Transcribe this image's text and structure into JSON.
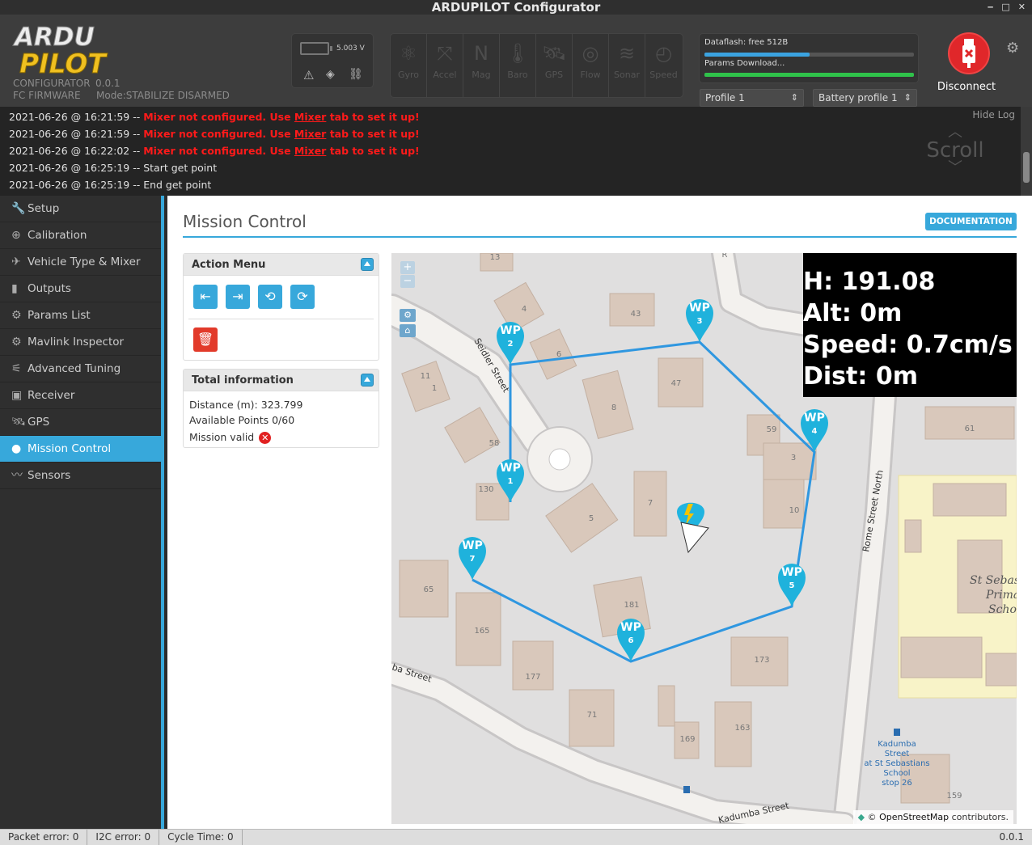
{
  "window": {
    "title": "ARDUPILOT Configurator",
    "controls": [
      "‒",
      "□",
      "✕"
    ]
  },
  "header": {
    "logo_top": "ARDU",
    "logo_bottom": "PILOT",
    "configurator_label": "CONFIGURATOR",
    "version": "0.0.1",
    "fc_firmware_label": "FC FIRMWARE",
    "mode": "Mode:STABILIZE DISARMED",
    "voltage": "5.003 V",
    "status_icons": [
      "warning-icon",
      "gps-fix-icon",
      "link-icon"
    ],
    "sensors": [
      {
        "label": "Gyro",
        "icon": "gyro-icon"
      },
      {
        "label": "Accel",
        "icon": "accel-icon"
      },
      {
        "label": "Mag",
        "icon": "mag-icon"
      },
      {
        "label": "Baro",
        "icon": "baro-icon"
      },
      {
        "label": "GPS",
        "icon": "gps-icon"
      },
      {
        "label": "Flow",
        "icon": "flow-icon"
      },
      {
        "label": "Sonar",
        "icon": "sonar-icon"
      },
      {
        "label": "Speed",
        "icon": "speed-icon"
      }
    ],
    "dataflash_label": "Dataflash: free 512B",
    "dataflash_fraction": 0.5,
    "params_label": "Params Download...",
    "params_fraction": 1.0,
    "profile": "Profile 1",
    "battery_profile": "Battery profile 1",
    "disconnect_label": "Disconnect"
  },
  "log": {
    "hide_label": "Hide Log",
    "scroll_label": "Scroll",
    "lines": [
      {
        "time": "2021-06-26 @ 16:21:59 -- ",
        "pre": "Mixer not configured. Use ",
        "link": "Mixer",
        "post": " tab to set it up!",
        "plain": ""
      },
      {
        "time": "2021-06-26 @ 16:21:59 -- ",
        "pre": "Mixer not configured. Use ",
        "link": "Mixer",
        "post": " tab to set it up!",
        "plain": ""
      },
      {
        "time": "2021-06-26 @ 16:22:02 -- ",
        "pre": "Mixer not configured. Use ",
        "link": "Mixer",
        "post": " tab to set it up!",
        "plain": ""
      },
      {
        "time": "2021-06-26 @ 16:25:19 -- ",
        "pre": "",
        "link": "",
        "post": "",
        "plain": "Start get point"
      },
      {
        "time": "2021-06-26 @ 16:25:19 -- ",
        "pre": "",
        "link": "",
        "post": "",
        "plain": "End get point"
      }
    ]
  },
  "sidebar": {
    "items": [
      {
        "label": "Setup",
        "icon": "wrench-icon",
        "active": false
      },
      {
        "label": "Calibration",
        "icon": "crosshair-icon",
        "active": false
      },
      {
        "label": "Vehicle Type & Mixer",
        "icon": "vehicle-icon",
        "active": false
      },
      {
        "label": "Outputs",
        "icon": "outputs-icon",
        "active": false
      },
      {
        "label": "Params List",
        "icon": "gear-icon",
        "active": false
      },
      {
        "label": "Mavlink Inspector",
        "icon": "gear-icon",
        "active": false
      },
      {
        "label": "Advanced Tuning",
        "icon": "tuning-icon",
        "active": false
      },
      {
        "label": "Receiver",
        "icon": "receiver-icon",
        "active": false
      },
      {
        "label": "GPS",
        "icon": "satellite-icon",
        "active": false
      },
      {
        "label": "Mission Control",
        "icon": "map-pin-icon",
        "active": true
      },
      {
        "label": "Sensors",
        "icon": "pulse-icon",
        "active": false
      }
    ]
  },
  "main": {
    "title": "Mission Control",
    "documentation_label": "DOCUMENTATION",
    "action_menu": {
      "title": "Action Menu",
      "buttons": [
        "load-from-file",
        "save-to-file",
        "load-from-fc",
        "save-to-fc"
      ],
      "delete_icon": "trash-icon"
    },
    "total_info": {
      "title": "Total information",
      "distance": "Distance (m): 323.799",
      "points": "Available Points 0/60",
      "valid": "Mission valid"
    }
  },
  "map": {
    "hud": {
      "heading": "H: 191.08",
      "alt": "Alt: 0m",
      "speed": "Speed: 0.7cm/s",
      "dist": "Dist: 0m"
    },
    "zoom_in": "+",
    "zoom_out": "−",
    "attribution_pre": "© ",
    "attribution_link": "OpenStreetMap",
    "attribution_post": " contributors.",
    "waypoint_label": "WP",
    "streets": [
      "Seidler Street",
      "Rome Street North",
      "Kadumba Street",
      "ba Street"
    ],
    "place": {
      "l1": "St Sebas",
      "l2": "Prima",
      "l3": "Schoo"
    },
    "bus_stop": [
      "Kadumba",
      "Street",
      "at St Sebastians",
      "School",
      "stop 26"
    ],
    "house_numbers": [
      "13",
      "4",
      "43",
      "R",
      "6",
      "11",
      "1",
      "47",
      "8",
      "59",
      "3",
      "61",
      "58",
      "5",
      "7",
      "10",
      "65",
      "181",
      "165",
      "177",
      "173",
      "71",
      "169",
      "163",
      "159",
      "130",
      "6"
    ],
    "waypoints": [
      {
        "n": "1"
      },
      {
        "n": "2"
      },
      {
        "n": "3"
      },
      {
        "n": "4"
      },
      {
        "n": "5"
      },
      {
        "n": "6"
      },
      {
        "n": "7"
      }
    ]
  },
  "status": {
    "packet_error": "Packet error: 0",
    "i2c_error": "I2C error: 0",
    "cycle_time": "Cycle Time: 0",
    "version": "0.0.1"
  },
  "colors": {
    "accent": "#37a8db",
    "error": "#ff1a1a",
    "disconnect": "#e0272a",
    "route": "#2f97e0"
  }
}
